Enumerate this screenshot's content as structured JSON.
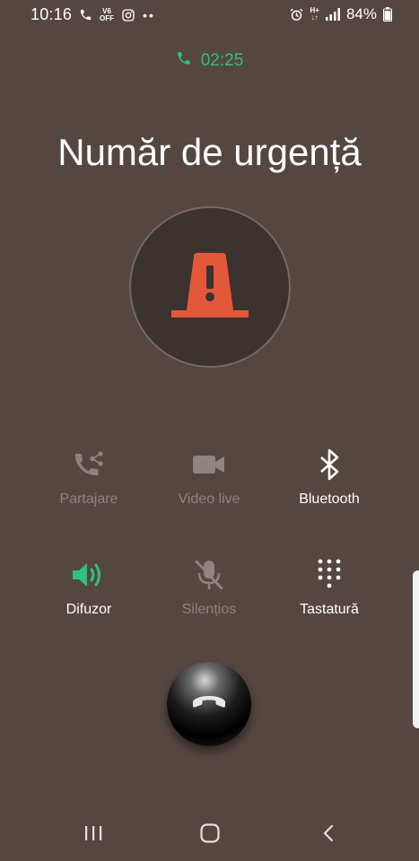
{
  "status_bar": {
    "time": "10:16",
    "volte_top": "V6",
    "volte_bottom": "OFF",
    "overflow_dots": "••",
    "network_top": "H+",
    "battery_percent": "84%"
  },
  "call": {
    "timer": "02:25",
    "caller_name": "Număr de urgență",
    "avatar_icon": "emergency-warning-icon",
    "colors": {
      "accent_green": "#2ec27e",
      "warning_orange": "#e4583a",
      "background": "#554641"
    }
  },
  "actions": [
    {
      "label": "Partajare",
      "icon": "share-call-icon",
      "enabled": false
    },
    {
      "label": "Video live",
      "icon": "video-camera-icon",
      "enabled": false
    },
    {
      "label": "Bluetooth",
      "icon": "bluetooth-icon",
      "enabled": true
    },
    {
      "label": "Difuzor",
      "icon": "speaker-icon",
      "enabled": true,
      "active": true
    },
    {
      "label": "Silențios",
      "icon": "mute-mic-icon",
      "enabled": false
    },
    {
      "label": "Tastatură",
      "icon": "dialpad-icon",
      "enabled": true
    }
  ],
  "end_call": {
    "icon": "end-call-icon"
  },
  "nav": {
    "recents": "recents-icon",
    "home": "home-icon",
    "back": "back-icon"
  }
}
